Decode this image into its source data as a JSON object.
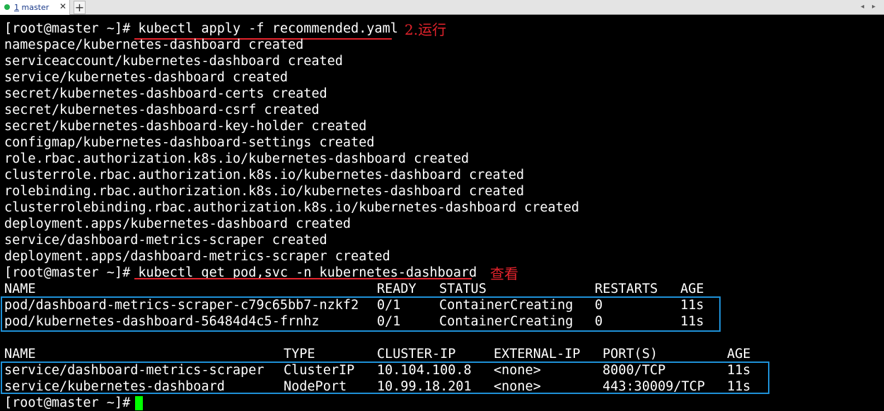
{
  "tab": {
    "number": "1",
    "name": "master",
    "close": "✕",
    "add": "+",
    "nav_left": "◂",
    "nav_right": "▸"
  },
  "terminal": {
    "prompt": "[root@master ~]#",
    "cmd1": "kubectl apply -f recommended.yaml",
    "annotation1": "2.运行",
    "apply_output": [
      "namespace/kubernetes-dashboard created",
      "serviceaccount/kubernetes-dashboard created",
      "service/kubernetes-dashboard created",
      "secret/kubernetes-dashboard-certs created",
      "secret/kubernetes-dashboard-csrf created",
      "secret/kubernetes-dashboard-key-holder created",
      "configmap/kubernetes-dashboard-settings created",
      "role.rbac.authorization.k8s.io/kubernetes-dashboard created",
      "clusterrole.rbac.authorization.k8s.io/kubernetes-dashboard created",
      "rolebinding.rbac.authorization.k8s.io/kubernetes-dashboard created",
      "clusterrolebinding.rbac.authorization.k8s.io/kubernetes-dashboard created",
      "deployment.apps/kubernetes-dashboard created",
      "service/dashboard-metrics-scraper created",
      "deployment.apps/dashboard-metrics-scraper created"
    ],
    "cmd2": "kubectl get pod,svc -n kubernetes-dashboard",
    "annotation2": "查看",
    "pods": {
      "headers": [
        "NAME",
        "READY",
        "STATUS",
        "RESTARTS",
        "AGE"
      ],
      "rows": [
        [
          "pod/dashboard-metrics-scraper-c79c65bb7-nzkf2",
          "0/1",
          "ContainerCreating",
          "0",
          "11s"
        ],
        [
          "pod/kubernetes-dashboard-56484d4c5-frnhz",
          "0/1",
          "ContainerCreating",
          "0",
          "11s"
        ]
      ]
    },
    "services": {
      "headers": [
        "NAME",
        "TYPE",
        "CLUSTER-IP",
        "EXTERNAL-IP",
        "PORT(S)",
        "AGE"
      ],
      "rows": [
        [
          "service/dashboard-metrics-scraper",
          "ClusterIP",
          "10.104.100.8",
          "<none>",
          "8000/TCP",
          "11s"
        ],
        [
          "service/kubernetes-dashboard",
          "NodePort",
          "10.99.18.201",
          "<none>",
          "443:30009/TCP",
          "11s"
        ]
      ]
    }
  },
  "colors": {
    "annotation": "#e3232c",
    "box": "#1e90d6",
    "cursor": "#00ff00",
    "text": "#ffffff",
    "background": "#000000"
  }
}
